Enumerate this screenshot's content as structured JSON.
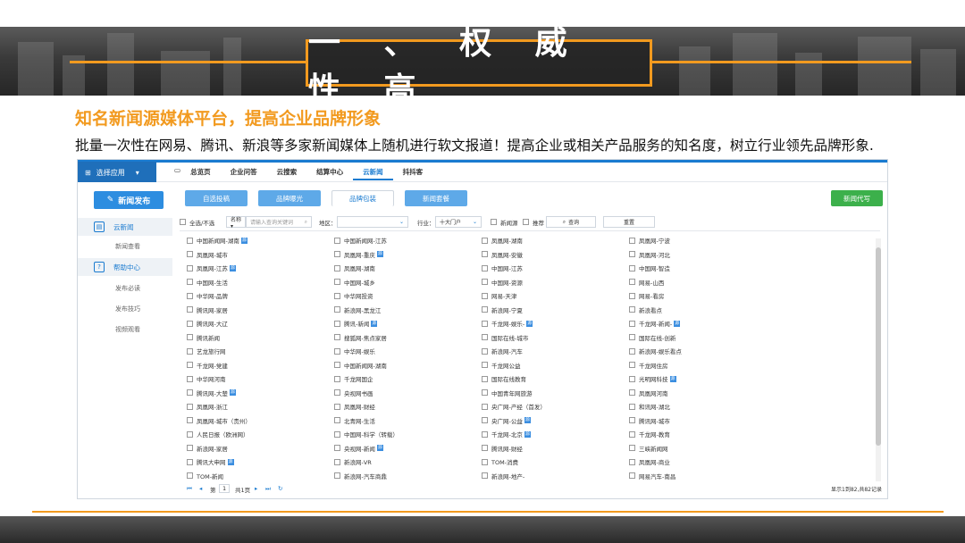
{
  "slide": {
    "title": "一 、 权 威 性 高",
    "subtitle": "知名新闻源媒体平台，提高企业品牌形象",
    "description": "批量一次性在网易、腾讯、新浪等多家新闻媒体上随机进行软文报道！提高企业或相关产品服务的知名度，树立行业领先品牌形象."
  },
  "app": {
    "app_selector": "选择应用",
    "nav": [
      "总览页",
      "企业问答",
      "云搜索",
      "结算中心",
      "云新闻",
      "抖抖客"
    ],
    "nav_active": "云新闻",
    "publish_button": "新闻发布",
    "sidebar": {
      "section1": "云新闻",
      "section1_items": [
        "新闻查看"
      ],
      "section2": "帮助中心",
      "section2_items": [
        "发布必读",
        "发布技巧",
        "视频观看"
      ]
    },
    "tabs": [
      "自选投稿",
      "品牌曝光",
      "品牌包装",
      "新闻套餐"
    ],
    "tab_active": "品牌包装",
    "green_button": "新闻代写",
    "filters": {
      "select_all": "全选/不选",
      "name_select": "名称 ▾",
      "search_placeholder": "请输入查询关键词",
      "region_label": "地区：",
      "industry_label": "行业：",
      "industry_value": "十大门户",
      "news_source": "新闻源",
      "recommend": "推荐",
      "query_button": "查询",
      "reset_button": "重置"
    },
    "media_rows": [
      [
        {
          "t": "中国新闻网-湖南",
          "b": true
        },
        {
          "t": "中国新闻网-江苏",
          "b": false
        },
        {
          "t": "凤凰网-湖南",
          "b": false
        },
        {
          "t": "凤凰网-宁波",
          "b": false
        }
      ],
      [
        {
          "t": "凤凰网-城市",
          "b": false
        },
        {
          "t": "凤凰网-重庆",
          "b": true
        },
        {
          "t": "凤凰网-安徽",
          "b": false
        },
        {
          "t": "凤凰网-河北",
          "b": false
        }
      ],
      [
        {
          "t": "凤凰网-江苏",
          "b": true
        },
        {
          "t": "凤凰网-湖南",
          "b": false
        },
        {
          "t": "中国网-江苏",
          "b": false
        },
        {
          "t": "中国网-智造",
          "b": false
        }
      ],
      [
        {
          "t": "中国网-生活",
          "b": false
        },
        {
          "t": "中国网-城乡",
          "b": false
        },
        {
          "t": "中国网-资源",
          "b": false
        },
        {
          "t": "网易-山西",
          "b": false
        }
      ],
      [
        {
          "t": "中华网-品牌",
          "b": false
        },
        {
          "t": "中华网投资",
          "b": false
        },
        {
          "t": "网易-天津",
          "b": false
        },
        {
          "t": "网易-看房",
          "b": false
        }
      ],
      [
        {
          "t": "腾讯网-家居",
          "b": false
        },
        {
          "t": "新浪网-黑龙江",
          "b": false
        },
        {
          "t": "新浪网-宁夏",
          "b": false
        },
        {
          "t": "新浪看点",
          "b": false
        }
      ],
      [
        {
          "t": "腾讯网-大辽",
          "b": false
        },
        {
          "t": "腾讯-新闻",
          "b": true
        },
        {
          "t": "千龙网-娱乐-",
          "b": true
        },
        {
          "t": "千龙网-新闻-",
          "b": true
        }
      ],
      [
        {
          "t": "腾讯新闻",
          "b": false
        },
        {
          "t": "搜狐网-焦点家居",
          "b": false
        },
        {
          "t": "国际在线-城市",
          "b": false
        },
        {
          "t": "国际在线-创新",
          "b": false
        }
      ],
      [
        {
          "t": "艺龙旅行网",
          "b": false
        },
        {
          "t": "中华网-娱乐",
          "b": false
        },
        {
          "t": "新浪网-汽车",
          "b": false
        },
        {
          "t": "新浪网-娱乐看点",
          "b": false
        }
      ],
      [
        {
          "t": "千龙网-党建",
          "b": false
        },
        {
          "t": "中国新闻网-湖南",
          "b": false
        },
        {
          "t": "千龙网公益",
          "b": false
        },
        {
          "t": "千龙网住房",
          "b": false
        }
      ],
      [
        {
          "t": "中华网河南",
          "b": false
        },
        {
          "t": "千龙网国企",
          "b": false
        },
        {
          "t": "国际在线教育",
          "b": false
        },
        {
          "t": "光明网科技",
          "b": true
        }
      ],
      [
        {
          "t": "腾讯网-大楚",
          "b": true
        },
        {
          "t": "央视网书画",
          "b": false
        },
        {
          "t": "中国青年网旅游",
          "b": false
        },
        {
          "t": "凤凰网河南",
          "b": false
        }
      ],
      [
        {
          "t": "凤凰网-浙江",
          "b": false
        },
        {
          "t": "凤凰网-财经",
          "b": false
        },
        {
          "t": "央广网-产经（首发）",
          "b": false
        },
        {
          "t": "和讯网-湖北",
          "b": false
        }
      ],
      [
        {
          "t": "凤凰网-城市（贵州）",
          "b": false
        },
        {
          "t": "北青网-生活",
          "b": false
        },
        {
          "t": "央广网-公益",
          "b": true
        },
        {
          "t": "腾讯网-城市",
          "b": false
        }
      ],
      [
        {
          "t": "人民日报（欧洲网）",
          "b": false
        },
        {
          "t": "中国网-科学（转载）",
          "b": false
        },
        {
          "t": "千龙网-北京",
          "b": true
        },
        {
          "t": "千龙网-教育",
          "b": false
        }
      ],
      [
        {
          "t": "新浪网-家居",
          "b": false
        },
        {
          "t": "央视网-新闻",
          "b": true
        },
        {
          "t": "腾讯网-财经",
          "b": false
        },
        {
          "t": "三峡新闻网",
          "b": false
        }
      ],
      [
        {
          "t": "腾讯大申网",
          "b": true
        },
        {
          "t": "新浪网-VR",
          "b": false
        },
        {
          "t": "TOM-消费",
          "b": false
        },
        {
          "t": "凤凰网-商业",
          "b": false
        }
      ],
      [
        {
          "t": "TOM-新闻",
          "b": false
        },
        {
          "t": "新浪网-汽车商鼎",
          "b": false
        },
        {
          "t": "新浪网-地产-",
          "b": false
        },
        {
          "t": "网易汽车-南昌",
          "b": false
        }
      ]
    ],
    "pager": {
      "page_label": "第",
      "page_value": "1",
      "total": "共1页",
      "summary": "显示1到82,共82记录"
    }
  },
  "colors": {
    "accent": "#f29a1f",
    "blue": "#1a7bd0",
    "green": "#3cb04b"
  }
}
